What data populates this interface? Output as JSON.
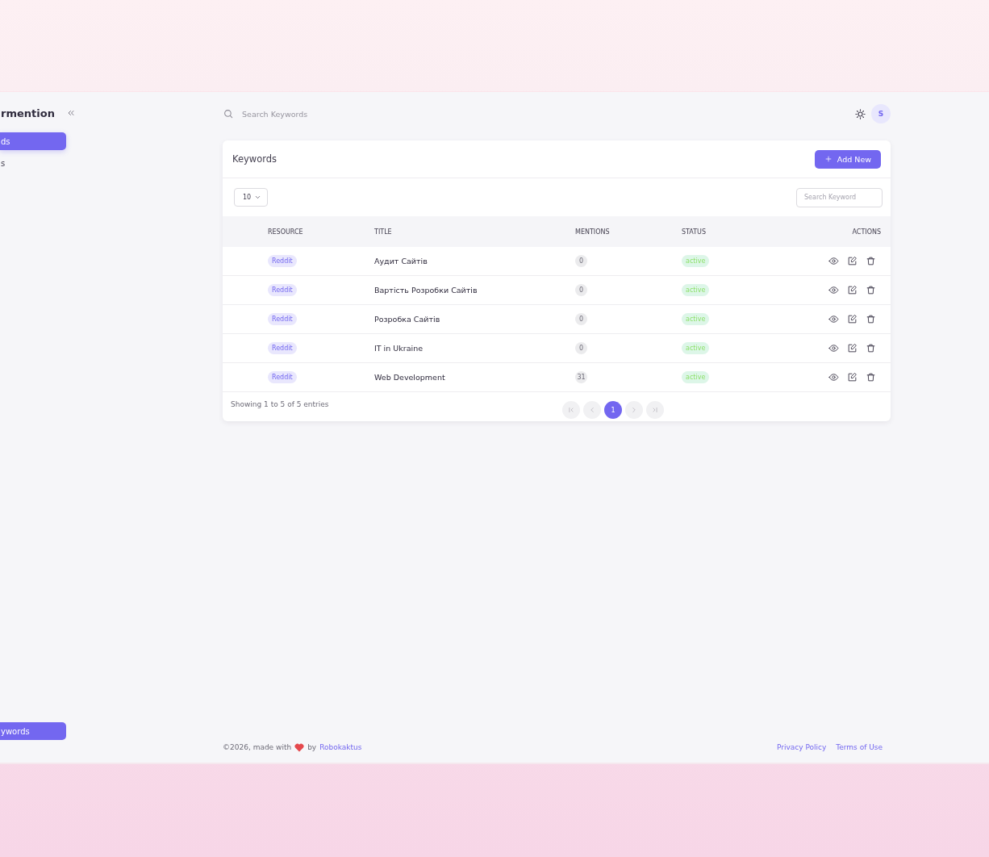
{
  "sidebar": {
    "brand": "rmention",
    "nav": [
      {
        "label": "ds",
        "selected": true
      },
      {
        "label": "s",
        "selected": false
      }
    ],
    "bottom_button": "ywords"
  },
  "topbar": {
    "search": {
      "placeholder": "Search Keywords"
    },
    "avatar": "S"
  },
  "card": {
    "title": "Keywords",
    "add_button": "Add New",
    "page_size": "10",
    "search": {
      "placeholder": "Search Keyword"
    },
    "table": {
      "columns": [
        "RESOURCE",
        "TITLE",
        "MENTIONS",
        "STATUS",
        "ACTIONS"
      ],
      "rows": [
        {
          "resource": "Reddit",
          "title": "Аудит Сайтів",
          "mentions": "0",
          "status": "active"
        },
        {
          "resource": "Reddit",
          "title": "Вартість Розробки Сайтів",
          "mentions": "0",
          "status": "active"
        },
        {
          "resource": "Reddit",
          "title": "Розробка Сайтів",
          "mentions": "0",
          "status": "active"
        },
        {
          "resource": "Reddit",
          "title": "IT in Ukraine",
          "mentions": "0",
          "status": "active"
        },
        {
          "resource": "Reddit",
          "title": "Web Development",
          "mentions": "31",
          "status": "active"
        }
      ]
    },
    "summary": "Showing 1 to 5 of 5 entries",
    "pages": [
      {
        "label": "1",
        "selected": true
      }
    ]
  },
  "footer": {
    "copyright_before": "©2026, made with",
    "copyright_by": "by",
    "author": "Robokaktus",
    "links": [
      "Privacy Policy",
      "Terms of Use"
    ]
  }
}
